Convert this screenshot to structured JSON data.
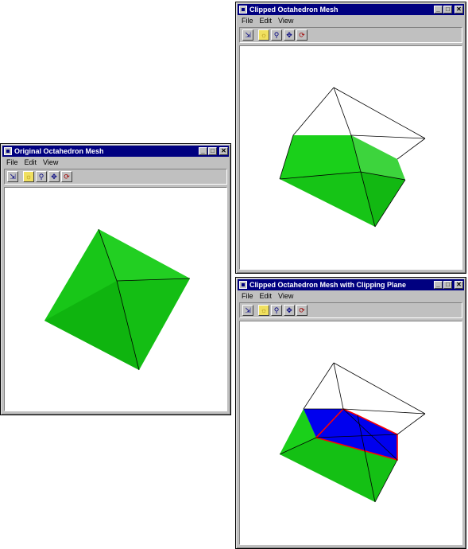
{
  "windows": {
    "original": {
      "title": "Original Octahedron Mesh",
      "menu": [
        "File",
        "Edit",
        "View"
      ]
    },
    "clipped": {
      "title": "Clipped Octahedron Mesh",
      "menu": [
        "File",
        "Edit",
        "View"
      ]
    },
    "clipped_plane": {
      "title": "Clipped Octahedron Mesh with Clipping Plane",
      "menu": [
        "File",
        "Edit",
        "View"
      ]
    }
  },
  "toolbar_icons": [
    "select-icon",
    "sun-icon",
    "zoom-icon",
    "pan-icon",
    "rotate-icon"
  ],
  "title_buttons": [
    "minimize-icon",
    "maximize-icon",
    "close-icon"
  ],
  "colors": {
    "mesh_fill": "#00cc00",
    "clip_plane_fill": "#0000ee",
    "clip_outline": "#ff0000",
    "edge": "#000000",
    "title_bar": "#000080"
  }
}
